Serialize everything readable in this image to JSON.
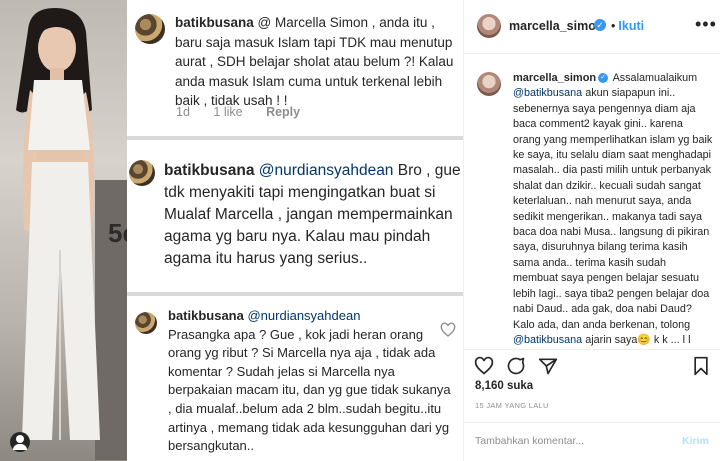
{
  "comments_screenshot": {
    "comment1": {
      "username": "batikbusana",
      "text": "@ Marcella Simon , anda itu , baru saja masuk Islam tapi TDK mau menutup aurat , SDH belajar sholat atau belum ?! Kalau anda masuk Islam cuma untuk terkenal lebih baik , tidak usah ! !",
      "age": "1d",
      "likes": "1 like",
      "reply": "Reply"
    },
    "comment2": {
      "username": "batikbusana",
      "mention": "@nurdiansyahdean",
      "text": "Bro , gue tdk menyakiti tapi mengingatkan buat si Mualaf Marcella , jangan mempermainkan agama yg baru nya. Kalau mau pindah agama itu harus yang serius.."
    },
    "comment3": {
      "username": "batikbusana",
      "mention": "@nurdiansyahdean",
      "text": "Prasangka apa ? Gue , kok jadi heran orang orang yg ribut ? Si Marcella nya aja , tidak ada komentar ? Sudah jelas si Marcella nya berpakaian macam itu, dan yg gue tidak sukanya , dia mualaf..belum ada 2 blm..sudah begitu..itu artinya , memang tidak ada kesungguhan dari yg bersangkutan.."
    }
  },
  "photo": {
    "overlay_text": "5e",
    "icons": [
      "user-tag-icon"
    ]
  },
  "post_panel": {
    "header": {
      "username": "marcella_simon",
      "verified_glyph": "✓",
      "separator": "•",
      "follow_label": "Ikuti",
      "more_glyph": "•••"
    },
    "caption": {
      "username": "marcella_simon",
      "mention1": "@batikbusana",
      "part1": "Assalamualaikum",
      "part2": "akun siapapun ini.. sebenernya saya pengennya diam aja baca comment2 kayak gini.. karena orang yang memperlihatkan islam yg baik ke saya, itu selalu diam saat menghadapi masalah.. dia pasti milih untuk perbanyak shalat dan dzikir.. kecuali sudah sangat keterlaluan.. nah menurut saya, anda sedikit mengerikan.. makanya tadi saya baca doa nabi Musa.. langsung di pikiran saya, disuruhnya bilang terima kasih sama anda.. terima kasih sudah membuat saya pengen belajar sesuatu lebih lagi.. saya tiba2 pengen belajar doa nabi Daud.. ada gak, doa nabi Daud? Kalo ada, dan anda berkenan, tolong",
      "mention2": "@batikbusana",
      "part3": "ajarin saya",
      "emoji": "😊",
      "part4": "k k ... l l"
    },
    "actions": {
      "icons": [
        "heart-icon",
        "comment-icon",
        "share-icon",
        "bookmark-icon"
      ]
    },
    "likes": "8,160 suka",
    "timestamp": "15 JAM YANG LALU",
    "comment_bar": {
      "placeholder": "Tambahkan komentar...",
      "post_label": "Kirim"
    }
  },
  "colors": {
    "accent": "#3897f0",
    "mention": "#00376b",
    "muted": "#8e8e8e",
    "text": "#262626"
  }
}
